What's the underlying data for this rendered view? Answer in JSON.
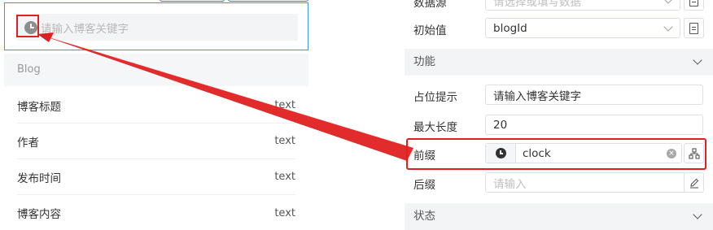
{
  "preview": {
    "search_placeholder": "请输入博客关键字",
    "list_header": "Blog",
    "rows": [
      {
        "label": "博客标题",
        "type": "text"
      },
      {
        "label": "作者",
        "type": "text"
      },
      {
        "label": "发布时间",
        "type": "text"
      },
      {
        "label": "博客内容",
        "type": "text"
      }
    ]
  },
  "props": {
    "data_source": {
      "label": "数据源",
      "placeholder": "请选择或填写数据"
    },
    "initial_value": {
      "label": "初始值",
      "value": "blogId"
    },
    "section_function": "功能",
    "placeholder_field": {
      "label": "占位提示",
      "value": "请输入博客关键字"
    },
    "max_length": {
      "label": "最大长度",
      "value": "20"
    },
    "prefix": {
      "label": "前缀",
      "value": "clock"
    },
    "suffix": {
      "label": "后缀",
      "placeholder": "请输入"
    },
    "section_state": "状态"
  },
  "colors": {
    "highlight": "#e02020",
    "focus_border": "#3d97d8"
  }
}
